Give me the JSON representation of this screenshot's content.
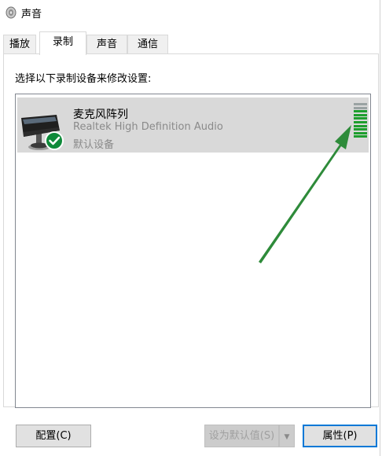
{
  "window": {
    "title": "声音"
  },
  "tabs": [
    {
      "label": "播放",
      "active": false
    },
    {
      "label": "录制",
      "active": true
    },
    {
      "label": "声音",
      "active": false
    },
    {
      "label": "通信",
      "active": false
    }
  ],
  "recording": {
    "instruction": "选择以下录制设备来修改设置:",
    "devices": [
      {
        "name": "麦克风阵列",
        "description": "Realtek High Definition Audio",
        "status": "默认设备",
        "is_default": true,
        "selected": true,
        "level_fraction": 0.8
      }
    ]
  },
  "buttons": {
    "configure": "配置(C)",
    "set_default": "设为默认值(S)",
    "set_default_dropdown": "▼",
    "properties": "属性(P)"
  },
  "colors": {
    "meter_active": "#1e9e2e",
    "meter_inactive": "#9aa3a3",
    "check_badge": "#0f8a3a",
    "arrow": "#2e8b3a",
    "selection": "#d9d9d9",
    "focus_border": "#0078d7"
  },
  "icons": {
    "app": "speaker-icon",
    "device": "microphone-array-icon",
    "badge": "checkmark-badge-icon",
    "dropdown": "chevron-down-icon"
  }
}
